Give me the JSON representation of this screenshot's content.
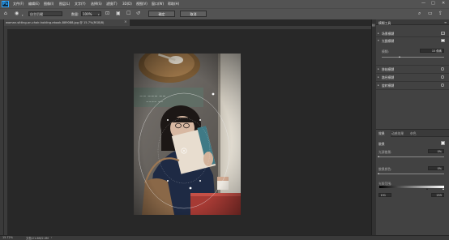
{
  "menubar": {
    "logo": "Ps",
    "items": [
      "文件(F)",
      "编辑(E)",
      "图像(I)",
      "图层(L)",
      "文字(Y)",
      "选择(S)",
      "滤镜(T)",
      "3D(D)",
      "视图(V)",
      "窗口(W)",
      "帮助(H)"
    ],
    "window_controls": [
      "—",
      "□",
      "✕"
    ]
  },
  "options": {
    "mode_value": "自主后缀",
    "size_label": "数量:",
    "size_value": "100%",
    "ok_label": "确定",
    "cancel_label": "取消"
  },
  "document": {
    "tab_title": "woman-sitting-on-chair-holding-ebook-889088.jpg @ 15.7%(RGB/8)",
    "close": "×"
  },
  "status": {
    "zoom": "15.72%",
    "info": "文档:21.6M/2.0M"
  },
  "blur_panel": {
    "title": "模糊工具",
    "rows": [
      {
        "label": "场景模糊",
        "checked": false
      },
      {
        "label": "光圈模糊",
        "checked": true
      },
      {
        "label": "移轴模糊",
        "checked": false
      },
      {
        "label": "路径模糊",
        "checked": false
      },
      {
        "label": "旋转模糊",
        "checked": false
      }
    ],
    "blur_label": "模糊:",
    "blur_value": "15 像素",
    "blur_fraction": 0.3
  },
  "effects_panel": {
    "tabs": [
      "效果",
      "动感效果",
      "杂色"
    ],
    "bokeh_label": "散景",
    "bokeh_checked": true,
    "light_bokeh_label": "光源散景:",
    "light_bokeh_value": "0%",
    "bokeh_color_label": "散景颜色:",
    "bokeh_color_value": "0%",
    "light_range_label": "光照范围:",
    "light_range_min": "191",
    "light_range_max": "255",
    "light_range_fraction": [
      0.75,
      1.0
    ]
  }
}
